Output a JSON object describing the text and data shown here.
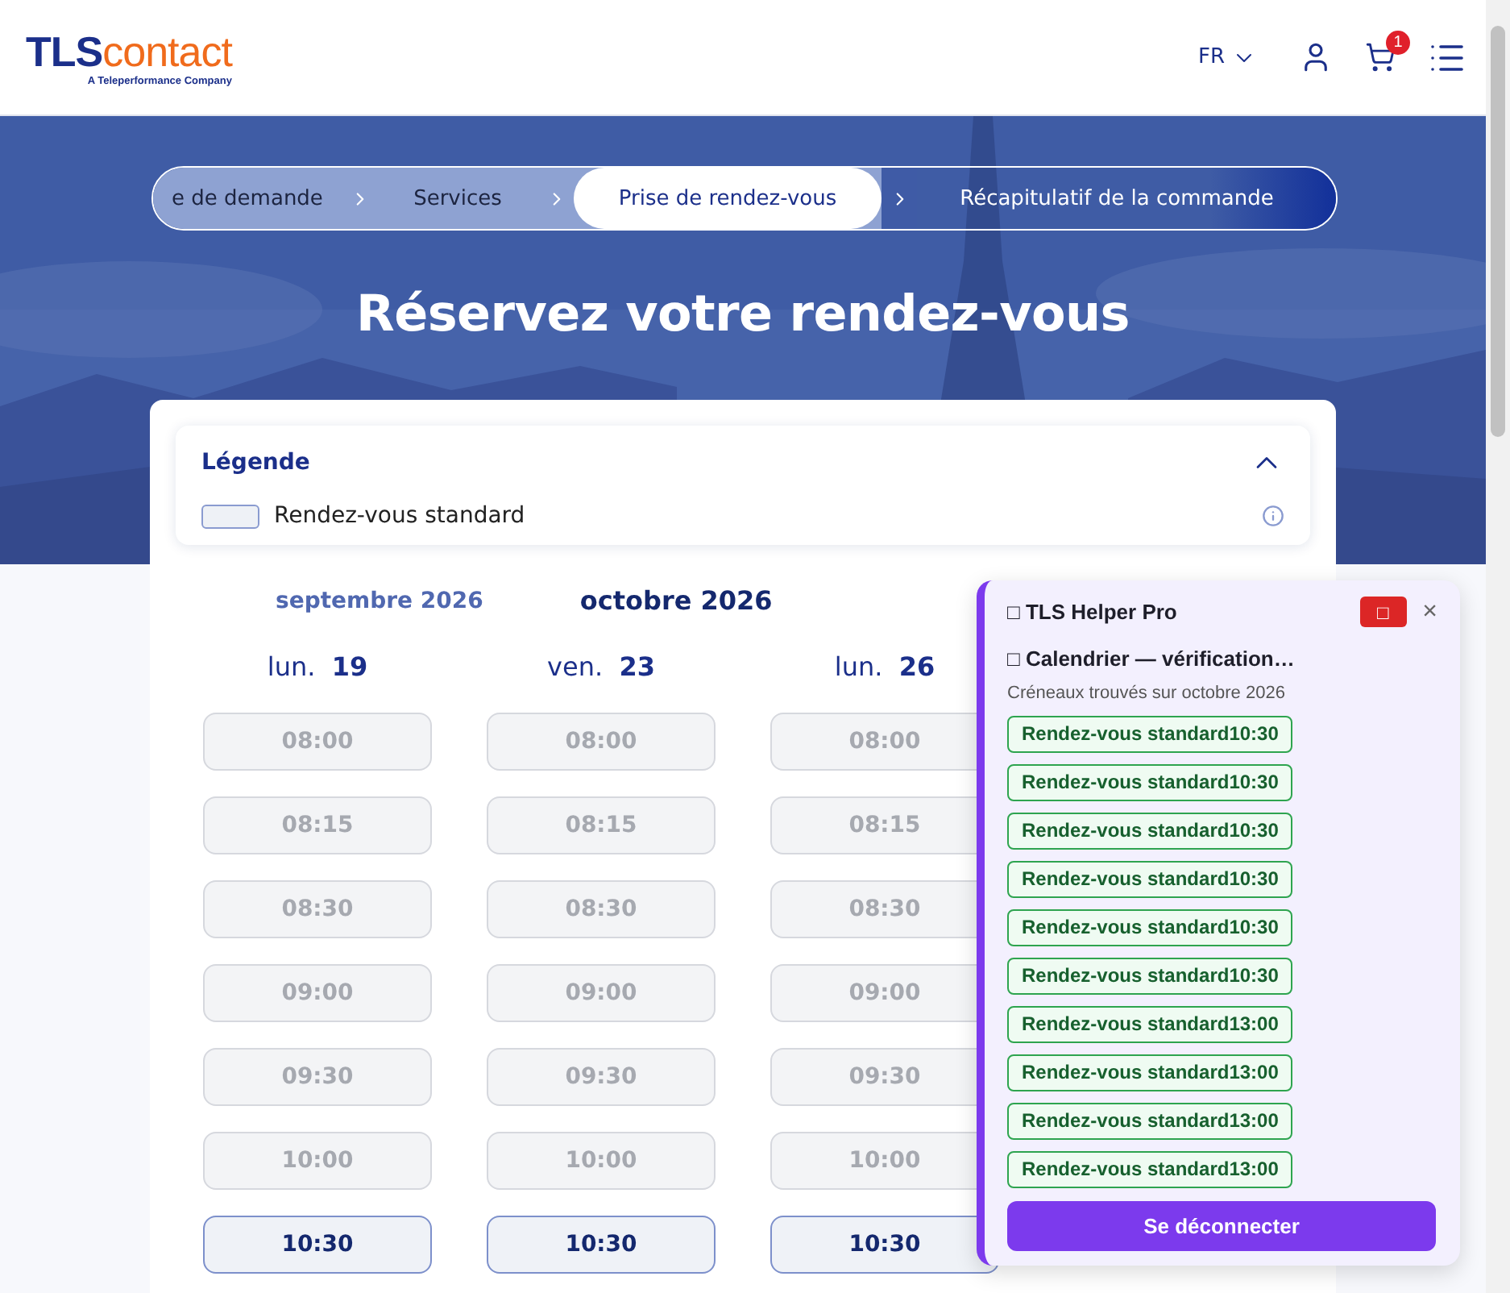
{
  "header": {
    "logo": {
      "brand": "TLS",
      "suffix": "contact",
      "tagline": "A Teleperformance Company"
    },
    "language": "FR",
    "cart_count": "1"
  },
  "stepper": [
    {
      "label": "e de demande",
      "kind": "done"
    },
    {
      "label": "Services",
      "kind": "done"
    },
    {
      "label": "Prise de rendez-vous",
      "kind": "current"
    },
    {
      "label": "Récapitulatif de la commande",
      "kind": "upcoming"
    }
  ],
  "page_title": "Réservez votre rendez-vous",
  "legend": {
    "title": "Légende",
    "expanded": true,
    "items": [
      {
        "label": "Rendez-vous standard"
      }
    ]
  },
  "months": [
    {
      "label": "septembre 2026",
      "selected": false
    },
    {
      "label": "octobre 2026",
      "selected": true
    }
  ],
  "days": [
    {
      "weekday": "lun.",
      "date": "19",
      "slots": [
        {
          "time": "08:00",
          "available": false
        },
        {
          "time": "08:15",
          "available": false
        },
        {
          "time": "08:30",
          "available": false
        },
        {
          "time": "09:00",
          "available": false
        },
        {
          "time": "09:30",
          "available": false
        },
        {
          "time": "10:00",
          "available": false
        },
        {
          "time": "10:30",
          "available": true
        }
      ]
    },
    {
      "weekday": "ven.",
      "date": "23",
      "slots": [
        {
          "time": "08:00",
          "available": false
        },
        {
          "time": "08:15",
          "available": false
        },
        {
          "time": "08:30",
          "available": false
        },
        {
          "time": "09:00",
          "available": false
        },
        {
          "time": "09:30",
          "available": false
        },
        {
          "time": "10:00",
          "available": false
        },
        {
          "time": "10:30",
          "available": true
        }
      ]
    },
    {
      "weekday": "lun.",
      "date": "26",
      "slots": [
        {
          "time": "08:00",
          "available": false
        },
        {
          "time": "08:15",
          "available": false
        },
        {
          "time": "08:30",
          "available": false
        },
        {
          "time": "09:00",
          "available": false
        },
        {
          "time": "09:30",
          "available": false
        },
        {
          "time": "10:00",
          "available": false
        },
        {
          "time": "10:30",
          "available": true
        }
      ]
    }
  ],
  "helper": {
    "title": "□ TLS Helper Pro",
    "stop_button": "□",
    "close": "×",
    "status": "□ Calendrier — vérification…",
    "subtitle": "Créneaux trouvés sur octobre 2026",
    "found": [
      "Rendez-vous standard10:30",
      "Rendez-vous standard10:30",
      "Rendez-vous standard10:30",
      "Rendez-vous standard10:30",
      "Rendez-vous standard10:30",
      "Rendez-vous standard10:30",
      "Rendez-vous standard13:00",
      "Rendez-vous standard13:00",
      "Rendez-vous standard13:00",
      "Rendez-vous standard13:00"
    ],
    "logout": "Se déconnecter"
  }
}
